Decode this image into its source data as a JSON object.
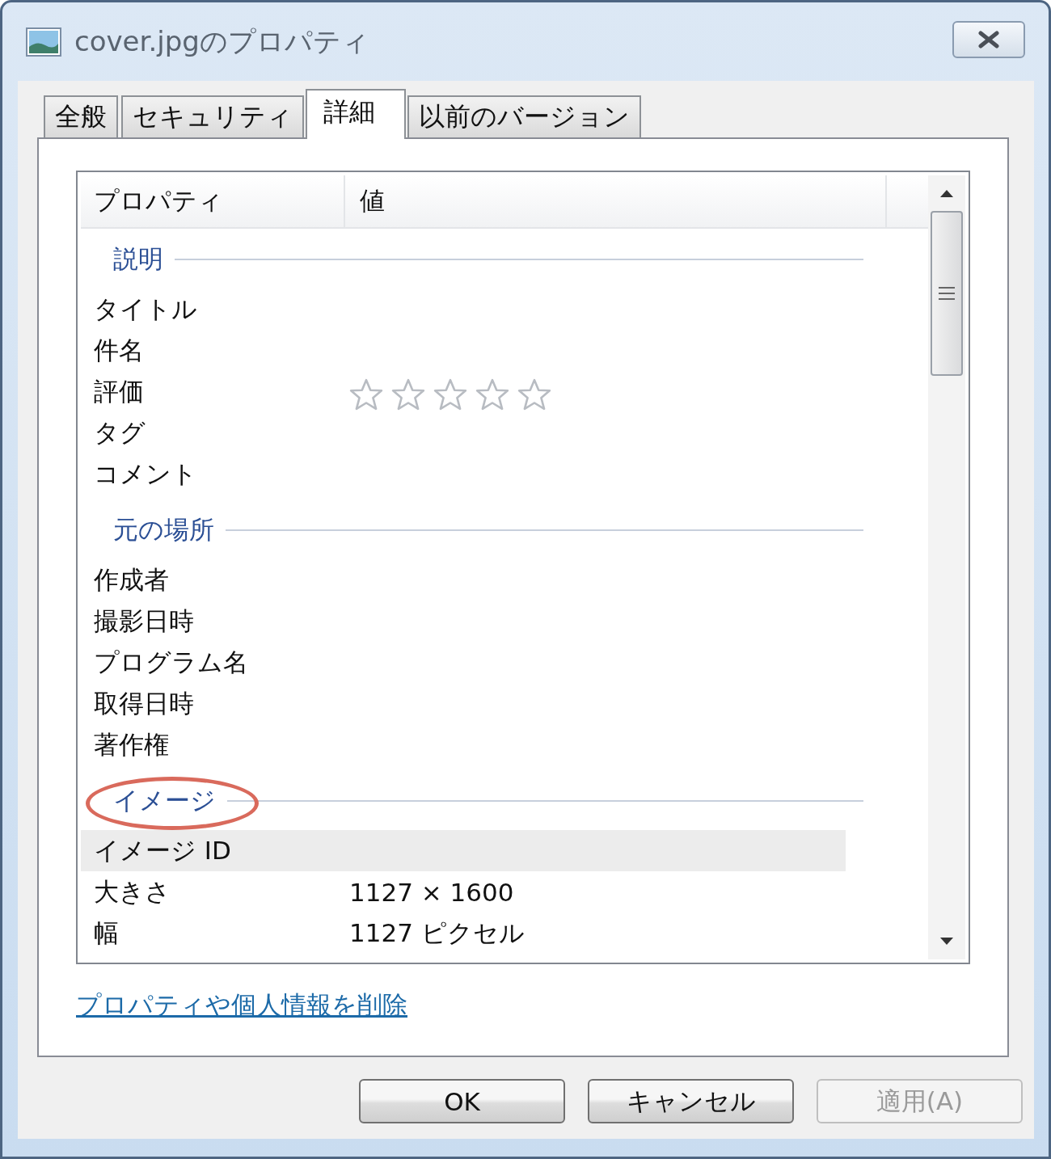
{
  "window": {
    "title": "cover.jpgのプロパティ"
  },
  "tabs": [
    {
      "label": "全般",
      "selected": false
    },
    {
      "label": "セキュリティ",
      "selected": false
    },
    {
      "label": "詳細",
      "selected": true
    },
    {
      "label": "以前のバージョン",
      "selected": false
    }
  ],
  "list": {
    "columns": [
      "プロパティ",
      "値"
    ],
    "groups": [
      {
        "name": "説明",
        "circled": false,
        "rows": [
          {
            "kind": "text",
            "property": "タイトル",
            "highlighted": false
          },
          {
            "kind": "text",
            "property": "件名",
            "highlighted": false
          },
          {
            "kind": "rating",
            "property": "評価",
            "stars": 0,
            "highlighted": false
          },
          {
            "kind": "text",
            "property": "タグ",
            "highlighted": false
          },
          {
            "kind": "text",
            "property": "コメント",
            "highlighted": false
          }
        ]
      },
      {
        "name": "元の場所",
        "circled": false,
        "rows": [
          {
            "kind": "text",
            "property": "作成者",
            "highlighted": false
          },
          {
            "kind": "text",
            "property": "撮影日時",
            "highlighted": false
          },
          {
            "kind": "text",
            "property": "プログラム名",
            "highlighted": false
          },
          {
            "kind": "text",
            "property": "取得日時",
            "highlighted": false
          },
          {
            "kind": "text",
            "property": "著作権",
            "highlighted": false
          }
        ]
      },
      {
        "name": "イメージ",
        "circled": true,
        "rows": [
          {
            "kind": "text",
            "property": "イメージ ID",
            "highlighted": true
          },
          {
            "kind": "text",
            "property": "大きさ",
            "value": "1127 × 1600",
            "highlighted": false
          },
          {
            "kind": "text",
            "property": "幅",
            "value": "1127 ピクセル",
            "highlighted": false
          }
        ]
      }
    ]
  },
  "link": "プロパティや個人情報を削除",
  "buttons": [
    {
      "label": "OK",
      "disabled": false
    },
    {
      "label": "キャンセル",
      "disabled": false
    },
    {
      "label": "適用(A)",
      "disabled": true
    }
  ]
}
